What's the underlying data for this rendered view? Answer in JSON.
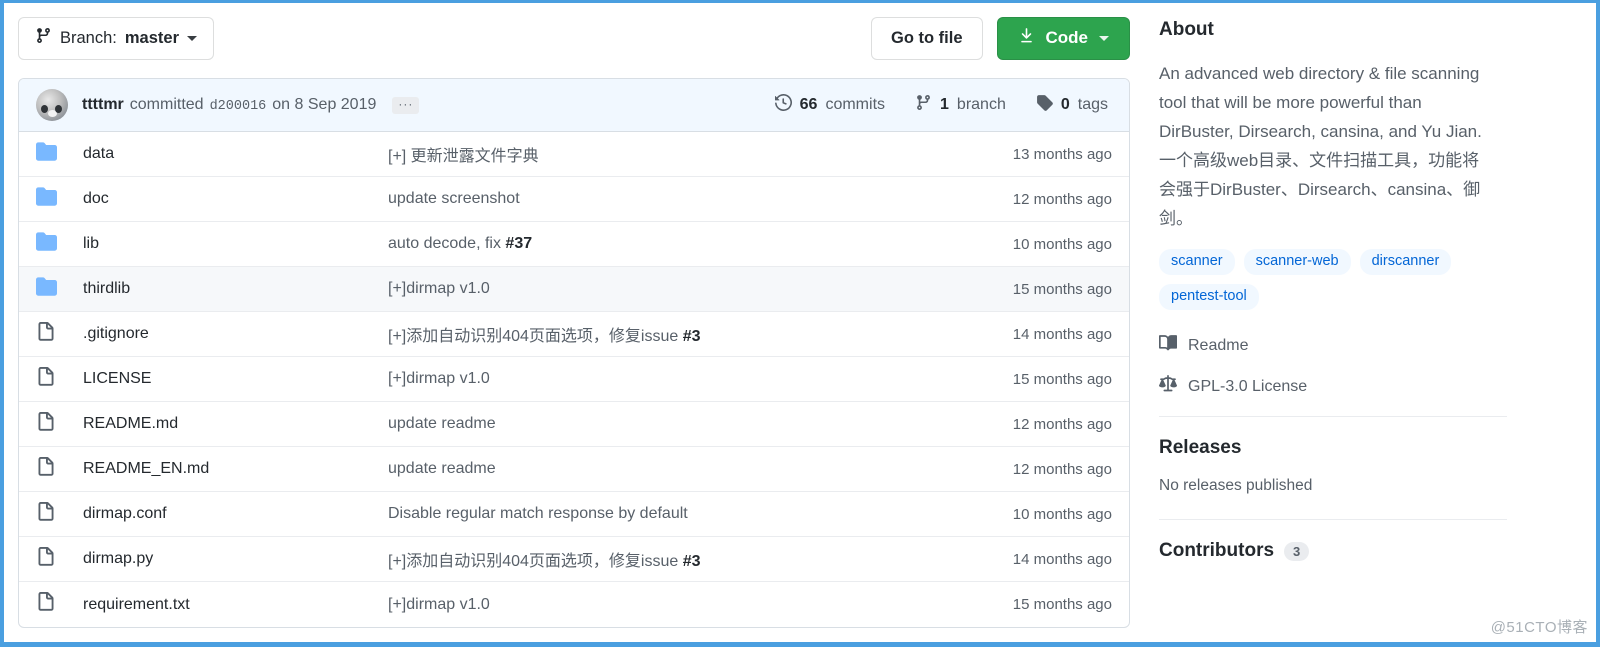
{
  "toolbar": {
    "branch_prefix": "Branch:",
    "branch_name": "master",
    "go_to_file_label": "Go to file",
    "code_label": "Code"
  },
  "commit_bar": {
    "author": "ttttmr",
    "verb": "committed",
    "sha": "d200016",
    "when": "on 8 Sep 2019",
    "ellipsis": "···",
    "commits_count": "66",
    "commits_label": "commits",
    "branches_count": "1",
    "branches_label": "branch",
    "tags_count": "0",
    "tags_label": "tags"
  },
  "files": [
    {
      "type": "folder",
      "name": "data",
      "message": "[+] 更新泄露文件字典",
      "issue": "",
      "age": "13 months ago",
      "highlight": false
    },
    {
      "type": "folder",
      "name": "doc",
      "message": "update screenshot",
      "issue": "",
      "age": "12 months ago",
      "highlight": false
    },
    {
      "type": "folder",
      "name": "lib",
      "message": "auto decode, fix ",
      "issue": "#37",
      "age": "10 months ago",
      "highlight": false
    },
    {
      "type": "folder",
      "name": "thirdlib",
      "message": "[+]dirmap v1.0",
      "issue": "",
      "age": "15 months ago",
      "highlight": true
    },
    {
      "type": "file",
      "name": ".gitignore",
      "message": "[+]添加自动识别404页面选项，修复issue ",
      "issue": "#3",
      "age": "14 months ago",
      "highlight": false
    },
    {
      "type": "file",
      "name": "LICENSE",
      "message": "[+]dirmap v1.0",
      "issue": "",
      "age": "15 months ago",
      "highlight": false
    },
    {
      "type": "file",
      "name": "README.md",
      "message": "update readme",
      "issue": "",
      "age": "12 months ago",
      "highlight": false
    },
    {
      "type": "file",
      "name": "README_EN.md",
      "message": "update readme",
      "issue": "",
      "age": "12 months ago",
      "highlight": false
    },
    {
      "type": "file",
      "name": "dirmap.conf",
      "message": "Disable regular match response by default",
      "issue": "",
      "age": "10 months ago",
      "highlight": false
    },
    {
      "type": "file",
      "name": "dirmap.py",
      "message": "[+]添加自动识别404页面选项，修复issue ",
      "issue": "#3",
      "age": "14 months ago",
      "highlight": false
    },
    {
      "type": "file",
      "name": "requirement.txt",
      "message": "[+]dirmap v1.0",
      "issue": "",
      "age": "15 months ago",
      "highlight": false
    }
  ],
  "sidebar": {
    "about_title": "About",
    "description": "An advanced web directory & file scanning tool that will be more powerful than DirBuster, Dirsearch, cansina, and Yu Jian.一个高级web目录、文件扫描工具，功能将会强于DirBuster、Dirsearch、cansina、御剑。",
    "topics": [
      "scanner",
      "scanner-web",
      "dirscanner",
      "pentest-tool"
    ],
    "readme_label": "Readme",
    "license_label": "GPL-3.0 License",
    "releases_title": "Releases",
    "releases_empty": "No releases published",
    "contributors_title": "Contributors",
    "contributors_count": "3"
  },
  "watermark": "@51CTO博客",
  "colors": {
    "green": "#2da44e",
    "link_blue": "#0366d6",
    "folder_blue": "#79b8ff",
    "commit_bar_bg": "#f1f8ff",
    "border": "#d8dee4",
    "muted_text": "#586069"
  }
}
